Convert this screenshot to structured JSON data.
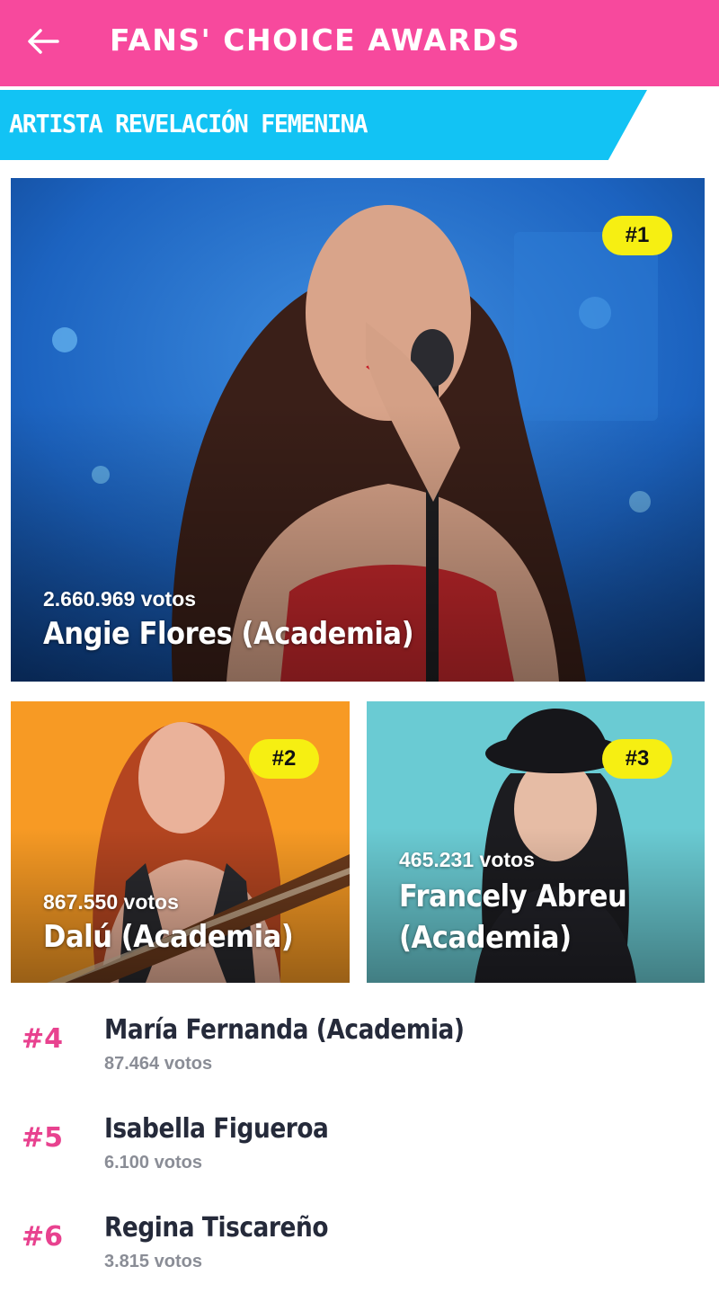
{
  "header": {
    "back_icon": "arrow-left-icon",
    "title": "FANS' CHOICE AWARDS",
    "bg_color": "#f7499d"
  },
  "category": {
    "label": "ARTISTA REVELACIÓN FEMENINA",
    "bg_color": "#12c3f4"
  },
  "featured": [
    {
      "rank": "#1",
      "votes": "2.660.969 votos",
      "name": "Angie Flores (Academia)"
    },
    {
      "rank": "#2",
      "votes": "867.550 votos",
      "name": "Dalú (Academia)"
    },
    {
      "rank": "#3",
      "votes": "465.231 votos",
      "name_line1": "Francely Abreu",
      "name_line2": "(Academia)"
    }
  ],
  "list": [
    {
      "rank": "#4",
      "name": "María Fernanda (Academia)",
      "votes": "87.464 votos"
    },
    {
      "rank": "#5",
      "name": "Isabella Figueroa",
      "votes": "6.100 votos"
    },
    {
      "rank": "#6",
      "name": "Regina Tiscareño",
      "votes": "3.815 votos"
    }
  ],
  "colors": {
    "badge": "#f6ef12",
    "rank_text": "#e8428f",
    "name_text": "#252a3a",
    "votes_text": "#8a8d96"
  }
}
